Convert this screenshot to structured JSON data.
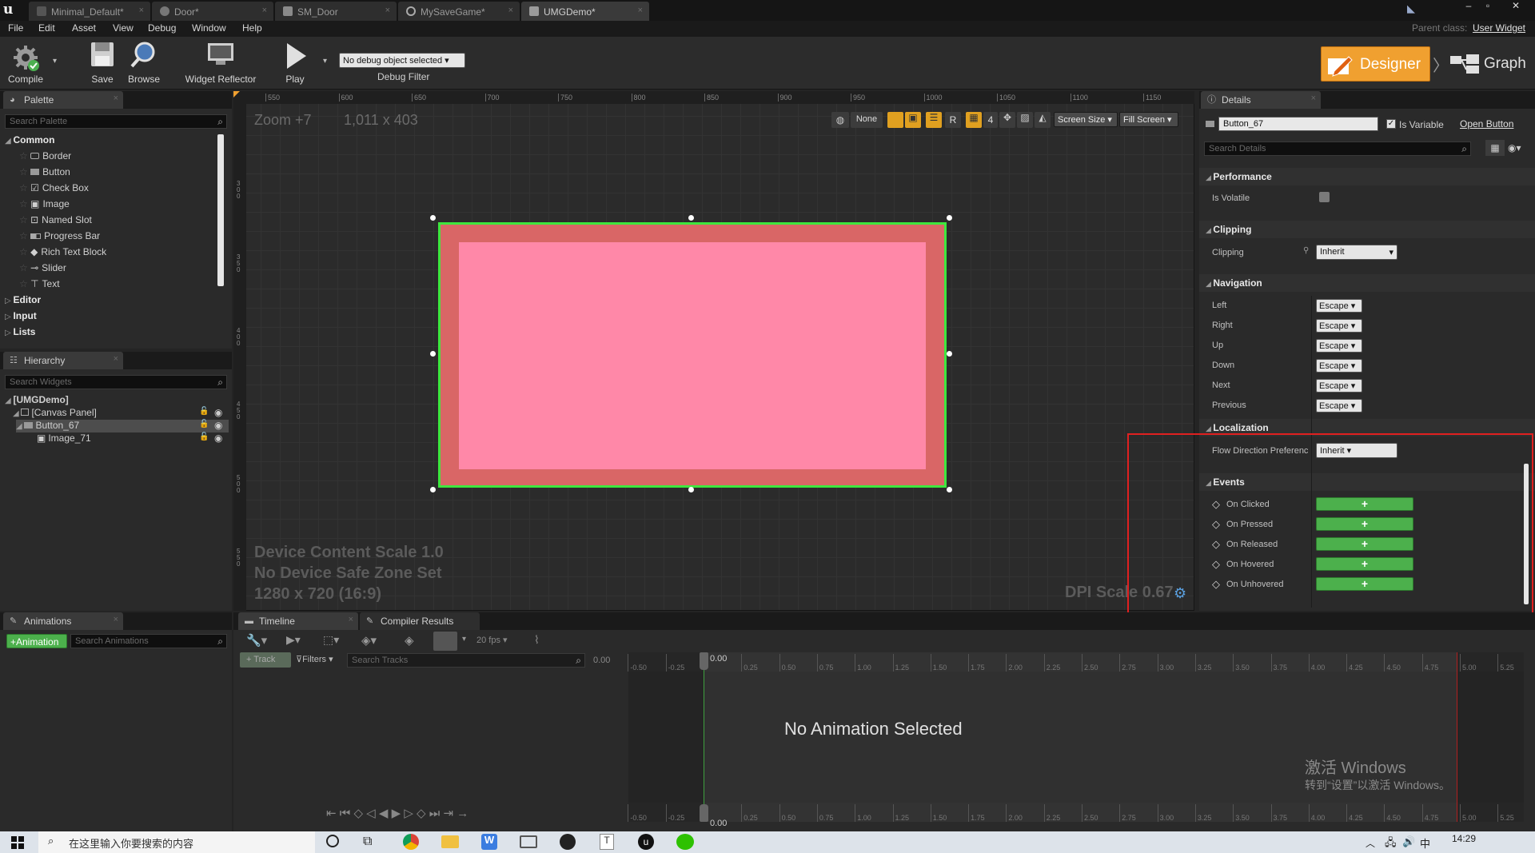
{
  "tabs": [
    {
      "label": "Minimal_Default*",
      "active": false
    },
    {
      "label": "Door*",
      "active": false
    },
    {
      "label": "SM_Door",
      "active": false
    },
    {
      "label": "MySaveGame*",
      "active": false
    },
    {
      "label": "UMGDemo*",
      "active": true
    }
  ],
  "parent_class": {
    "label": "Parent class:",
    "value": "User Widget"
  },
  "menu": [
    "File",
    "Edit",
    "Asset",
    "View",
    "Debug",
    "Window",
    "Help"
  ],
  "toolbar": {
    "compile": "Compile",
    "save": "Save",
    "browse": "Browse",
    "widget_reflector": "Widget Reflector",
    "play": "Play",
    "debug_select": "No debug object selected",
    "debug_filter": "Debug Filter",
    "designer": "Designer",
    "graph": "Graph"
  },
  "palette": {
    "tab": "Palette",
    "search_placeholder": "Search Palette",
    "common": "Common",
    "items": [
      "Border",
      "Button",
      "Check Box",
      "Image",
      "Named Slot",
      "Progress Bar",
      "Rich Text Block",
      "Slider",
      "Text"
    ],
    "categories": [
      "Editor",
      "Input",
      "Lists"
    ]
  },
  "hierarchy": {
    "tab": "Hierarchy",
    "search_placeholder": "Search Widgets",
    "items": [
      "[UMGDemo]",
      "[Canvas Panel]",
      "Button_67",
      "Image_71"
    ]
  },
  "designer": {
    "zoom": "Zoom +7",
    "resolution": "1,011 x 403",
    "ruler_ticks": [
      "550",
      "600",
      "650",
      "700",
      "750",
      "800",
      "850",
      "900",
      "950",
      "1000",
      "1050",
      "1100",
      "1150"
    ],
    "vruler_ticks": [
      "3\n0\n0",
      "3\n5\n0",
      "4\n0\n0",
      "4\n5\n0",
      "5\n0\n0",
      "5\n5\n0"
    ],
    "toolbar_none": "None",
    "toolbar_r": "R",
    "toolbar_4": "4",
    "screen_size": "Screen Size",
    "fill_screen": "Fill Screen",
    "device_scale": "Device Content Scale 1.0",
    "safe_zone": "No Device Safe Zone Set",
    "device_res": "1280 x 720 (16:9)",
    "dpi": "DPI Scale 0.67",
    "colors": {
      "button_outer": "#d96666",
      "button_inner": "#ff88a8",
      "selection": "#3ee63e"
    }
  },
  "details": {
    "tab": "Details",
    "widget_name": "Button_67",
    "is_variable": "Is Variable",
    "open_button": "Open Button",
    "search_placeholder": "Search Details",
    "performance": "Performance",
    "is_volatile": "Is Volatile",
    "clipping_section": "Clipping",
    "clipping_label": "Clipping",
    "clipping_value": "Inherit",
    "navigation": "Navigation",
    "nav_rows": [
      {
        "label": "Left",
        "value": "Escape"
      },
      {
        "label": "Right",
        "value": "Escape"
      },
      {
        "label": "Up",
        "value": "Escape"
      },
      {
        "label": "Down",
        "value": "Escape"
      },
      {
        "label": "Next",
        "value": "Escape"
      },
      {
        "label": "Previous",
        "value": "Escape"
      }
    ],
    "localization": "Localization",
    "flow_direction_label": "Flow Direction Preferenc",
    "flow_direction_value": "Inherit",
    "events": "Events",
    "event_rows": [
      "On Clicked",
      "On Pressed",
      "On Released",
      "On Hovered",
      "On Unhovered"
    ],
    "highlight_color": "#e02020"
  },
  "animations": {
    "tab": "Animations",
    "add_button": "+Animation",
    "search_placeholder": "Search Animations"
  },
  "timeline": {
    "tab": "Timeline",
    "compiler_tab": "Compiler Results",
    "fps": "20 fps",
    "track": "+ Track",
    "filters": "Filters",
    "search_tracks": "Search Tracks",
    "time_value": "0.00",
    "cursor_top": "0.00",
    "cursor_bottom": "0.00",
    "no_animation": "No Animation Selected",
    "ticks": [
      "-0.50",
      "-0.25",
      "0.25",
      "0.50",
      "0.75",
      "1.00",
      "1.25",
      "1.50",
      "1.75",
      "2.00",
      "2.25",
      "2.50",
      "2.75",
      "3.00",
      "3.25",
      "3.50",
      "3.75",
      "4.00",
      "4.25",
      "4.50",
      "4.75",
      "5.00",
      "5.25"
    ]
  },
  "watermark": {
    "line1": "激活 Windows",
    "line2": "转到“设置”以激活 Windows。"
  },
  "taskbar": {
    "search_placeholder": "在这里输入你要搜索的内容",
    "time": "14:29",
    "ime": "中"
  }
}
